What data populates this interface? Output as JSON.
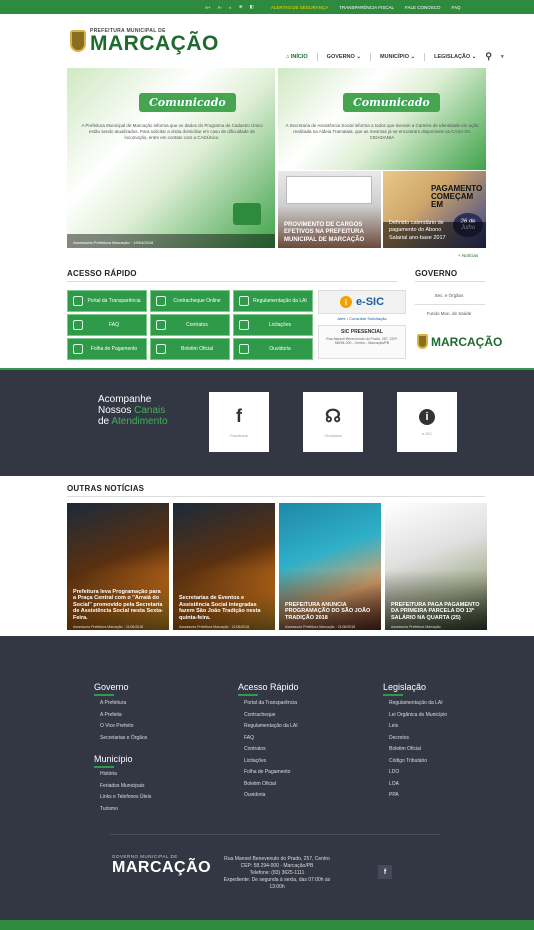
{
  "topbar": {
    "accessibility": [
      "A+",
      "A-",
      "◐",
      "⊕",
      "◧"
    ],
    "links": [
      "ALERTAS DE SEGURANÇA",
      "TRANSPARÊNCIA FISCAL",
      "FALE CONOSCO",
      "FAQ"
    ]
  },
  "header": {
    "logo_small": "PREFEITURA MUNICIPAL DE",
    "logo_big": "MARCAÇÃO",
    "nav": [
      "INÍCIO",
      "GOVERNO",
      "MUNICÍPIO",
      "LEGISLAÇÃO"
    ]
  },
  "slides": {
    "s1_title": "Comunicado",
    "s1_text": "A Prefeitura Municipal de Marcação informa que os dados do Programa de Cadastro Único estão sendo atualizados. Para solicitar a visita domiciliar em caso de dificuldade de locomoção, entre em contato com a CADÚnico.",
    "s1_caption": "Assessoria Prefeitura Marcação · 19/04/2018",
    "s2_title": "Comunicado",
    "s2_text": "A Secretaria de Assistência Social informa a todos que tiveram a Carteira de Identidade em ação realizada na Aldeia Tramataia, que as mesmas já se encontram disponíveis na CASA DA CIDADANIA",
    "s3_text": "PROVIMENTO DE CARGOS EFETIVOS NA PREFEITURA MUNICIPAL DE MARCAÇÃO",
    "s4_title": "PAGAMENTO COMEÇAM EM",
    "s4_date": "26 de Julho",
    "s4_text": "Definido calendário de pagamento do Abono Salarial ano-base 2017",
    "more": "+ Notícias"
  },
  "quick": {
    "title": "ACESSO RÁPIDO",
    "items": [
      "Portal da Transparência",
      "Contracheque Online",
      "Regulamentação da LAI",
      "FAQ",
      "Contratos",
      "Licitações",
      "Folha de Pagamento",
      "Boletim Oficial",
      "Ouvidoria"
    ],
    "esic": "e-SIC",
    "esic_links": "Abrir / Consultar Solicitação",
    "sic_title": "SIC PRESENCIAL",
    "sic_text": "Rua Manoel Benevenuto do Prado, 257, CEP: 58294-000 - Centro - Marcação/PB"
  },
  "gov": {
    "title": "GOVERNO",
    "links": [
      "Sec. e Órgãos",
      "Fundo Mun. de Saúde"
    ],
    "logo": "MARCAÇÃO"
  },
  "social": {
    "heading_1": "Acompanhe",
    "heading_2": "Nossos",
    "heading_accent_1": "Canais",
    "heading_3": "de",
    "heading_accent_2": "Atendimento",
    "items": [
      {
        "icon": "f",
        "label": "Facebook"
      },
      {
        "icon": "☊",
        "label": "Ouvidoria"
      },
      {
        "icon": "i",
        "label": "e-SIC"
      }
    ]
  },
  "news": {
    "title": "OUTRAS NOTÍCIAS",
    "items": [
      {
        "text": "Prefeitura leva Programação para a Praça Central com o \"Arraiá do Social\" promovido pela Secretaria de Assistência Social nesta Sexta-Feira.",
        "meta": "Assessoria Prefeitura Marcação · 21/06/2018"
      },
      {
        "text": "Secretarias de Eventos e Assistência Social integradas fazem São João Tradição nesta quinta-feira.",
        "meta": "Assessoria Prefeitura Marcação · 21/06/2018"
      },
      {
        "text": "PREFEITURA ANUNCIA PROGRAMAÇÃO DO SÃO JOÃO TRADIÇÃO 2018",
        "meta": "Assessoria Prefeitura Marcação · 21/06/2018"
      },
      {
        "text": "PREFEITURA PAGA PAGAMENTO DA PRIMEIRA PARCELA DO 13º SALÁRIO NA QUARTA (25)",
        "meta": "Assessoria Prefeitura Marcação"
      }
    ]
  },
  "footer": {
    "governo": {
      "title": "Governo",
      "links": [
        "A Prefeitura",
        "A Prefeita",
        "O Vice Prefeito",
        "Secretarias e Órgãos"
      ]
    },
    "municipio": {
      "title": "Município",
      "links": [
        "História",
        "Feriados Municipais",
        "Links e Telefones Úteis",
        "Turismo"
      ]
    },
    "acesso": {
      "title": "Acesso Rápido",
      "links": [
        "Portal da Transparência",
        "Contracheque",
        "Regulamentação da LAI",
        "FAQ",
        "Contratos",
        "Licitações",
        "Folha de Pagamento",
        "Boletim Oficial",
        "Ouvidoria"
      ]
    },
    "legis": {
      "title": "Legislação",
      "links": [
        "Regulamentação da LAI",
        "Lei Orgânica do Município",
        "Leis",
        "Decretos",
        "Boletim Oficial",
        "Código Tributário",
        "LDO",
        "LOA",
        "PPA"
      ]
    },
    "logo_small": "GOVERNO MUNICIPAL DE",
    "logo_big": "MARCAÇÃO",
    "address": "Rua Manoel Benevenuto do Prado, 257, Centro",
    "cep": "CEP: 58.294-000 - Marcação/PB",
    "phone": "Telefone: (83) 3625-1111",
    "hours": "Expediente: De segunda à sexta, das 07:00h às 13:00h",
    "fb": "f"
  }
}
